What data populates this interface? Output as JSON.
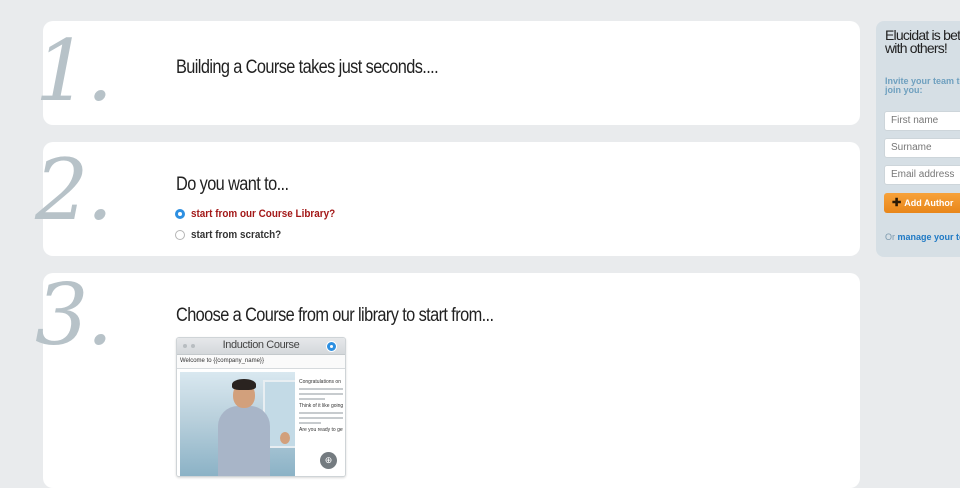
{
  "steps": [
    {
      "number": "1.",
      "heading": "Building a Course takes just seconds...."
    },
    {
      "number": "2.",
      "heading": "Do you want to...",
      "options": [
        {
          "label": "start from our Course Library?",
          "selected": true
        },
        {
          "label": "start from scratch?",
          "selected": false
        }
      ]
    },
    {
      "number": "3.",
      "heading": "Choose a Course from our library to start from..."
    }
  ],
  "course_card": {
    "title": "Induction Course",
    "subtitle": "Welcome to {{company_name}}",
    "side_heading": "Congratulations on",
    "side_heading2": "Think of it like going on",
    "side_heading3": "Are you ready to get started?",
    "zoom_icon": "zoom-in-icon"
  },
  "sidebar": {
    "title": "Elucidat is better with others!",
    "subtitle": "Invite your team to join you:",
    "first_name_placeholder": "First name",
    "surname_placeholder": "Surname",
    "email_placeholder": "Email address",
    "add_button_label": "Add Author",
    "manage_prefix": "Or",
    "manage_link": "manage your team"
  },
  "colors": {
    "background": "#e9ebed",
    "selected_option": "#a31818",
    "radio_selected": "#2d8fe1",
    "button": "#f29a2e",
    "sidebar": "#d6dfe5"
  }
}
